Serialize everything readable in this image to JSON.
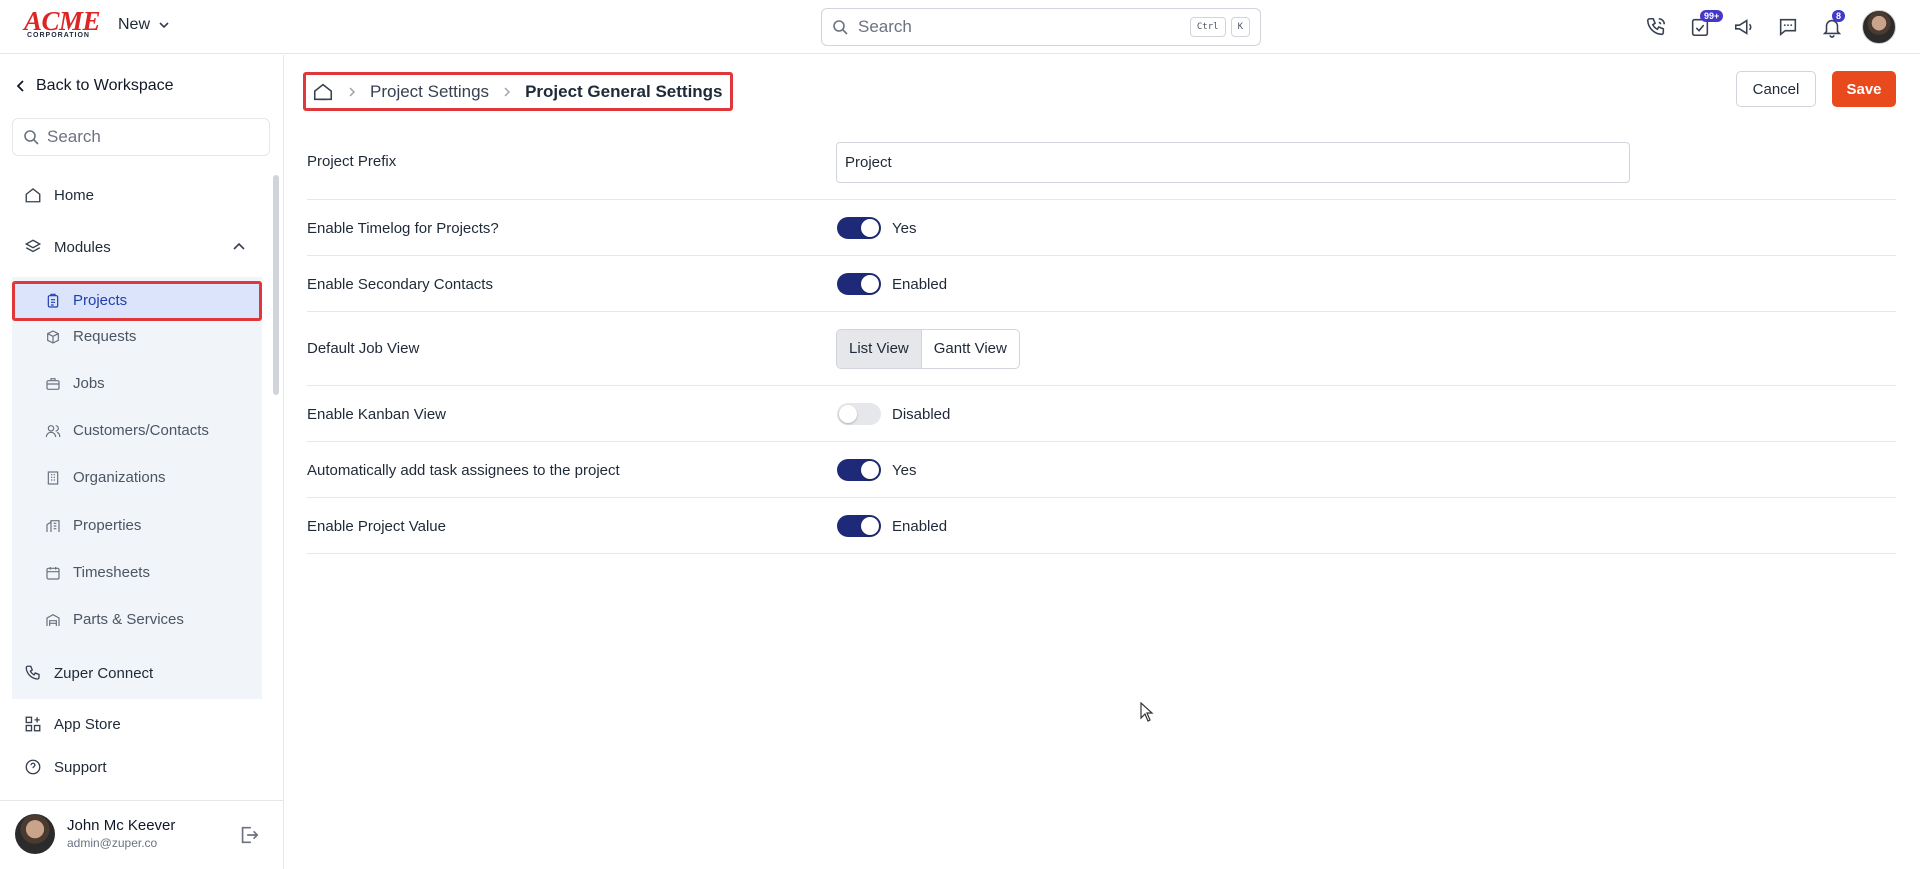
{
  "topbar": {
    "logo_text": "ACME",
    "logo_sub": "CORPORATION",
    "new_label": "New",
    "search_placeholder": "Search",
    "kbd_ctrl": "Ctrl",
    "kbd_k": "K",
    "tasks_badge": "99+",
    "notifications_badge": "8"
  },
  "sidebar": {
    "back_label": "Back to Workspace",
    "search_placeholder": "Search",
    "home": "Home",
    "modules": "Modules",
    "module_items": [
      "Projects",
      "Requests",
      "Jobs",
      "Customers/Contacts",
      "Organizations",
      "Properties",
      "Timesheets",
      "Parts & Services"
    ],
    "zuper_connect": "Zuper Connect",
    "app_store": "App Store",
    "support": "Support",
    "user_name": "John Mc Keever",
    "user_email": "admin@zuper.co"
  },
  "breadcrumb": {
    "level1": "Project Settings",
    "current": "Project General Settings"
  },
  "actions": {
    "cancel": "Cancel",
    "save": "Save"
  },
  "settings": {
    "prefix_label": "Project Prefix",
    "prefix_value": "Project",
    "timelog_label": "Enable Timelog for Projects?",
    "timelog_state": "Yes",
    "secondary_label": "Enable Secondary Contacts",
    "secondary_state": "Enabled",
    "jobview_label": "Default Job View",
    "jobview_options": [
      "List View",
      "Gantt View"
    ],
    "kanban_label": "Enable Kanban View",
    "kanban_state": "Disabled",
    "auto_assign_label": "Automatically add task assignees to the project",
    "auto_assign_state": "Yes",
    "project_value_label": "Enable Project Value",
    "project_value_state": "Enabled"
  },
  "colors": {
    "primary": "#1e2a78",
    "save": "#e8491d",
    "highlight": "#e0373b"
  }
}
